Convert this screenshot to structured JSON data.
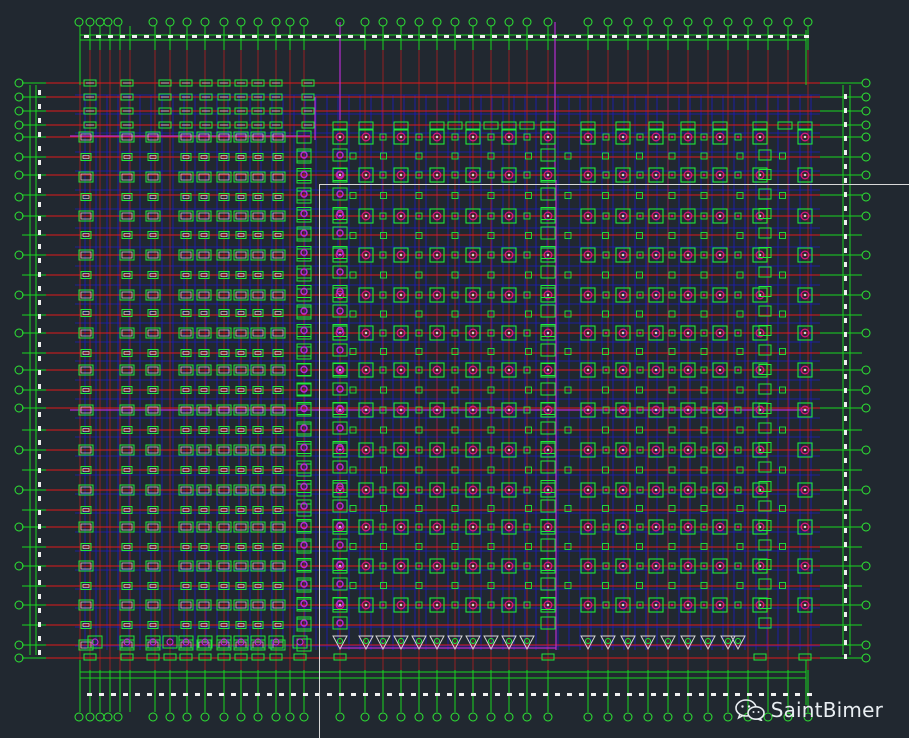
{
  "app": {
    "watermark_text": "SaintBimer",
    "watermark_icon": "wechat-icon"
  },
  "colors": {
    "background": "#212830",
    "axis_lines": "#e01a1a",
    "grid_lines": "#19d61f",
    "beam_lines": "#1c1cc8",
    "column": "#20e83a",
    "column_inner": "#d6d6d6",
    "pile": "#d21a7a",
    "highlight": "#b52cd0",
    "bubble": "#2ee634",
    "tick_marks": "#f0f0f0"
  },
  "drawing": {
    "type": "structural-column-layout-plan",
    "axis_count_horizontal": 35,
    "axis_count_vertical": 15
  }
}
